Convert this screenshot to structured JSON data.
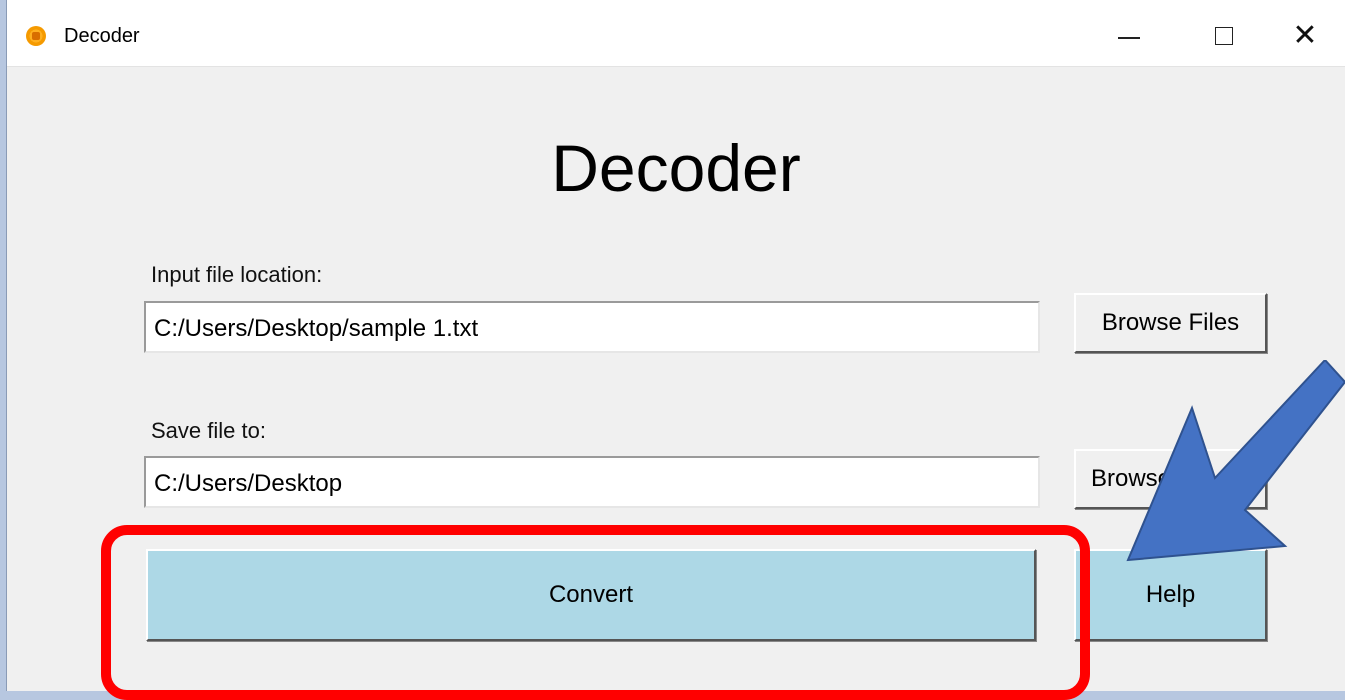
{
  "window": {
    "title": "Decoder",
    "controls": {
      "minimize": "minimize-icon",
      "maximize": "maximize-icon",
      "close": "close-icon"
    }
  },
  "main": {
    "heading": "Decoder",
    "input": {
      "label": "Input file location:",
      "value": "C:/Users/Desktop/sample 1.txt",
      "browse_label": "Browse Files"
    },
    "save": {
      "label": "Save file to:",
      "value": "C:/Users/Desktop",
      "browse_label": "Browse"
    },
    "convert_label": "Convert",
    "help_label": "Help"
  },
  "annotations": {
    "highlight_color": "#ff0000",
    "arrow_color": "#4472c4"
  },
  "colors": {
    "window_bg": "#f0f0f0",
    "action_button_bg": "#add8e6"
  }
}
